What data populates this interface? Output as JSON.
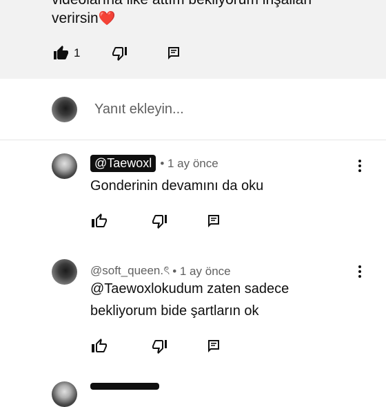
{
  "top_comment": {
    "partial_line": "videolarına like attım bekliyorum inşallah",
    "text": "verirsin",
    "emoji": "❤️",
    "like_count": "1"
  },
  "reply_box": {
    "placeholder": "Yanıt ekleyin..."
  },
  "replies": [
    {
      "handle": "@Taewoxl",
      "time": "• 1 ay önce",
      "lines": [
        "Gonderinin devamını da oku"
      ]
    },
    {
      "handle": "@soft_queen.ৎ",
      "time": "• 1 ay önce",
      "lines": [
        "@Taewoxlokudum zaten sadece",
        "bekliyorum bide şartların ok"
      ]
    }
  ],
  "icons": {
    "like_filled": "thumbs-up-filled-icon",
    "like": "thumbs-up-icon",
    "dislike": "thumbs-down-icon",
    "reply": "reply-comment-icon",
    "menu": "more-vertical-icon"
  }
}
